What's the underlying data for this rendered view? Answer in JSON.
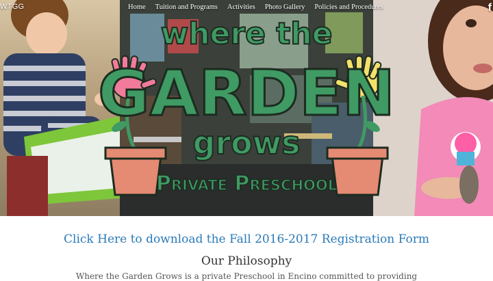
{
  "site": {
    "brand": "WTGG"
  },
  "nav": {
    "items": [
      {
        "label": "Home"
      },
      {
        "label": "Tuition and Programs"
      },
      {
        "label": "Activities"
      },
      {
        "label": "Photo Gallery"
      },
      {
        "label": "Policies and Procedures"
      }
    ],
    "social_glyph": "f"
  },
  "hero": {
    "logo_line1": "where the",
    "logo_line2": "GARDEN",
    "logo_line3": "grows",
    "logo_line4": "Private Preschool"
  },
  "content": {
    "registration_link": "Click Here to download the Fall 2016-2017 Registration Form",
    "philosophy_title": "Our Philosophy",
    "philosophy_text": "Where the Garden Grows is a private Preschool in Encino committed to providing"
  },
  "colors": {
    "logo_green": "#3f9a63",
    "logo_outline": "#1c2b20",
    "pot": "#e58a73",
    "pink_hand": "#f27a9a",
    "yellow_hand": "#f4e16a",
    "link": "#2a7ab8"
  },
  "icons": [
    "facebook-icon",
    "pink-handprint-icon",
    "yellow-handprint-icon",
    "flower-pot-icon"
  ]
}
